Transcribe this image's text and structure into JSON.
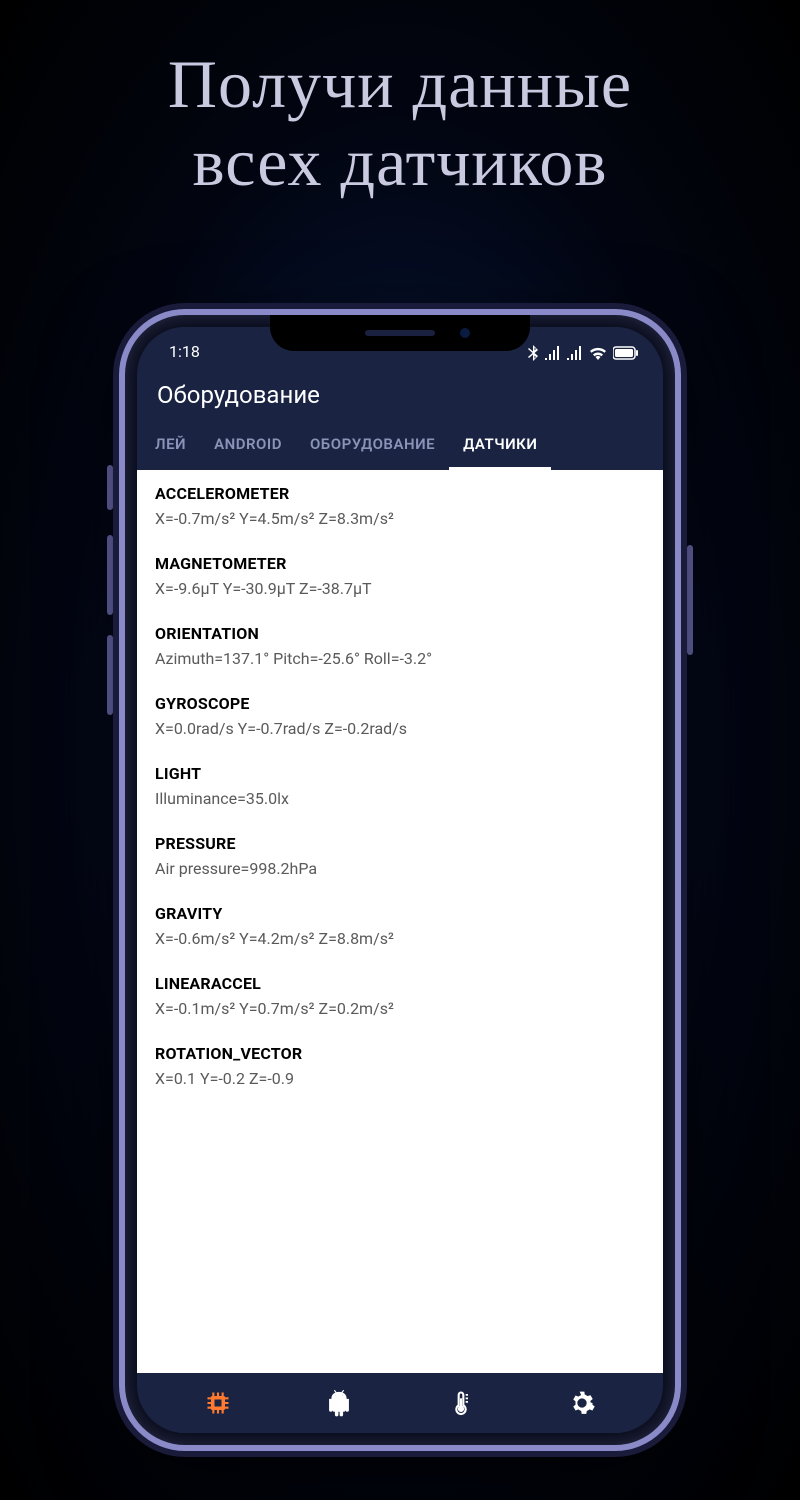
{
  "headline_line1": "Получи данные",
  "headline_line2": "всех датчиков",
  "status": {
    "time": "1:18"
  },
  "app": {
    "title": "Оборудование"
  },
  "tabs": [
    {
      "label": "ЛЕЙ",
      "active": false
    },
    {
      "label": "ANDROID",
      "active": false
    },
    {
      "label": "ОБОРУДОВАНИЕ",
      "active": false
    },
    {
      "label": "ДАТЧИКИ",
      "active": true
    }
  ],
  "sensors": [
    {
      "name": "ACCELEROMETER",
      "value": "X=-0.7m/s²  Y=4.5m/s²  Z=8.3m/s²"
    },
    {
      "name": "MAGNETOMETER",
      "value": "X=-9.6µT  Y=-30.9µT  Z=-38.7µT"
    },
    {
      "name": "ORIENTATION",
      "value": "Azimuth=137.1°  Pitch=-25.6°  Roll=-3.2°"
    },
    {
      "name": "GYROSCOPE",
      "value": "X=0.0rad/s  Y=-0.7rad/s  Z=-0.2rad/s"
    },
    {
      "name": "LIGHT",
      "value": "Illuminance=35.0lx"
    },
    {
      "name": "PRESSURE",
      "value": "Air pressure=998.2hPa"
    },
    {
      "name": "GRAVITY",
      "value": "X=-0.6m/s²  Y=4.2m/s²  Z=8.8m/s²"
    },
    {
      "name": "LINEARACCEL",
      "value": "X=-0.1m/s²  Y=0.7m/s²  Z=0.2m/s²"
    },
    {
      "name": "ROTATION_VECTOR",
      "value": "X=0.1  Y=-0.2  Z=-0.9"
    }
  ],
  "nav": {
    "items": [
      "chip",
      "android",
      "thermometer",
      "settings"
    ],
    "active_index": 0
  },
  "colors": {
    "accent": "#ff7a2e",
    "header_bg": "#1a2442",
    "inactive_tab": "#8a94b8"
  }
}
